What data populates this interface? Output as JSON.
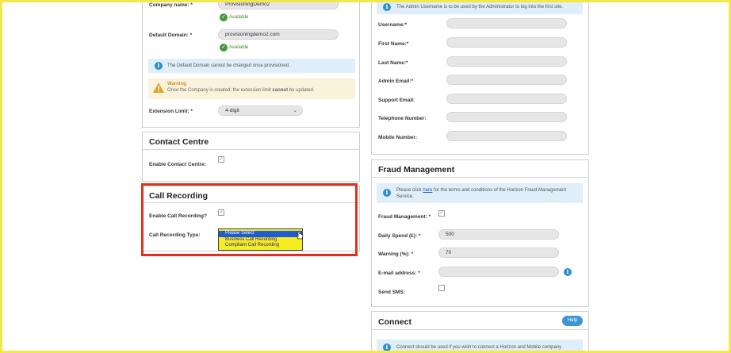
{
  "company": {
    "company_name_label": "Company name:",
    "company_name_value": "ProvisioningDemo2",
    "available_1": "Available",
    "default_domain_label": "Default Domain:",
    "default_domain_value": "provisioningdemo2.com",
    "available_2": "Available",
    "domain_info": "The Default Domain cannot be changed once provisioned.",
    "warning_title": "Warning",
    "warning_text_1": "Once the Company is created, the extension limit ",
    "warning_text_bold": "cannot",
    "warning_text_2": " be updated.",
    "extension_limit_label": "Extension Limit:",
    "extension_limit_value": "4-digit",
    "required": "*"
  },
  "contact_centre": {
    "title": "Contact Centre",
    "enable_label": "Enable Contact Centre:"
  },
  "call_recording": {
    "title": "Call Recording",
    "enable_label": "Enable Call Recording?",
    "type_label": "Call Recording Type:",
    "options": [
      "Please Select",
      "Business Call Recording",
      "Compliant Call Recording"
    ],
    "selected_index": 0
  },
  "admin": {
    "info": "The Admin Username is to be used by the Administrator to log into the first site.",
    "username_label": "Username:",
    "first_name_label": "First Name:",
    "last_name_label": "Last Name:",
    "admin_email_label": "Admin Email:",
    "support_email_label": "Support Email:",
    "telephone_label": "Telephone Number:",
    "mobile_label": "Mobile Number:"
  },
  "fraud": {
    "title": "Fraud Management",
    "info_1": "Please click ",
    "info_link": "here",
    "info_2": " for the terms and conditions of the Horizon Fraud Management Service.",
    "fraud_label": "Fraud Management:",
    "daily_spend_label": "Daily Spend (£):",
    "daily_spend_value": "500",
    "warning_label": "Warning (%):",
    "warning_value": "70",
    "email_label": "E-mail address:",
    "send_sms_label": "Send SMS:"
  },
  "connect": {
    "title": "Connect",
    "help_label": "Help",
    "info": "Connect should be used if you wish to connect a Horizon and Mobile company together."
  },
  "colors": {
    "accent_blue": "#2c8fd0",
    "highlight_red": "#e0311f",
    "success_green": "#3f9b3a",
    "page_border_yellow": "#f3e84a"
  }
}
